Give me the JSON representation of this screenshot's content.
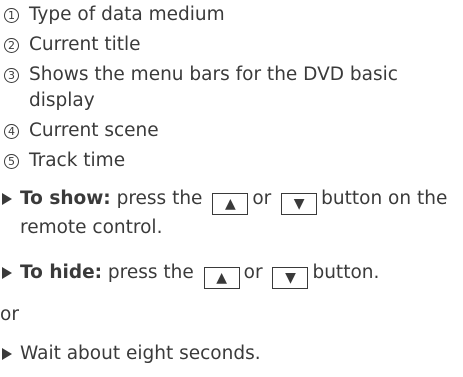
{
  "legend": [
    {
      "number": "1",
      "text": "Type of data medium"
    },
    {
      "number": "2",
      "text": "Current title"
    },
    {
      "number": "3",
      "text": "Shows the menu bars for the DVD basic display"
    },
    {
      "number": "4",
      "text": "Current scene"
    },
    {
      "number": "5",
      "text": "Track time"
    }
  ],
  "steps": {
    "show": {
      "label": "To show:",
      "pre": " press the",
      "key_up": "▲",
      "mid": "or",
      "key_down": "▼",
      "post": "button on the remote control."
    },
    "hide": {
      "label": "To hide:",
      "pre": " press the",
      "key_up": "▲",
      "mid": "or",
      "key_down": "▼",
      "post": "button."
    },
    "or_text": "or",
    "wait": {
      "text": "Wait about eight seconds."
    }
  }
}
